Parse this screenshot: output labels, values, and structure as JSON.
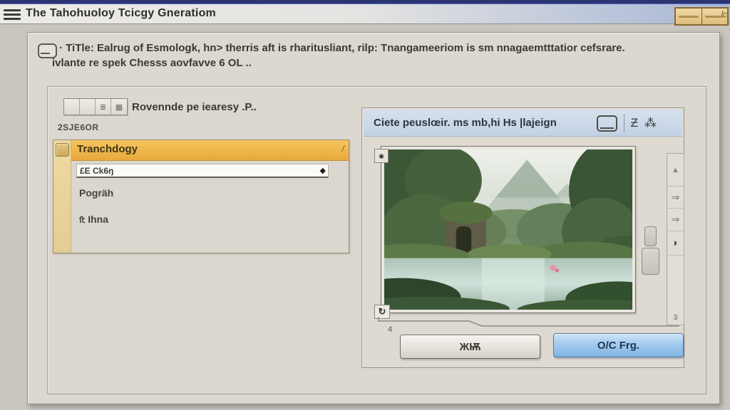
{
  "titlebar": {
    "title": "The Tahohuoloy Tcicgy Gneratiom",
    "corner_text": "ſc"
  },
  "info": {
    "line1": "· TiTle: Ealrug of Esmologk, hn> therris aft is rharitusliant, rilp: Tnangameeriom is sm nnagaemtttatior cefsrare.",
    "line2": "ivlante re spek Chesss aovfavve 6 OL .."
  },
  "left_panel": {
    "toolbar_glyphs": [
      "",
      "",
      "≣",
      "▦"
    ],
    "toolbar_label": "Rovennde pe iearesy .P..",
    "section_label": "2SJE6OR",
    "list": {
      "header": "Tranchdogy",
      "header_mark": "/",
      "input_value": "£E Ck6ŋ",
      "input_icon": "◆",
      "items": [
        {
          "prefix": "",
          "label": "Pogräh"
        },
        {
          "prefix": "ﬅ",
          "label": "Ihna"
        }
      ]
    }
  },
  "right_panel": {
    "header": "Ciete peuslœir. ms mb,hi Hs |lajeign",
    "header_icons": {
      "edit": "Ƶ",
      "cut": "⁂"
    },
    "corner_glyph": "◉",
    "rotate_glyph": "↻",
    "marker": "4",
    "scroll": {
      "up": "▲",
      "forward1": "⇒",
      "forward2": "⇒",
      "leaf": "◗",
      "num": "3"
    },
    "buttons": {
      "secondary": "ЖѬ",
      "primary": "O/C Frg."
    }
  },
  "colors": {
    "accent_orange": "#f0b54a",
    "stripe_tan": "#ead59e",
    "header_blue": "#ccd9ea",
    "button_blue": "#9cc8ec",
    "titlebar_navy": "#2c3472"
  }
}
